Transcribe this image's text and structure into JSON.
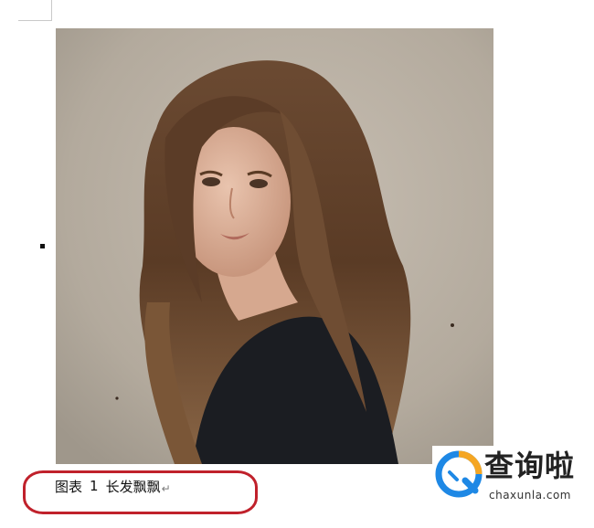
{
  "document": {
    "caption": {
      "label": "图表",
      "number": "1",
      "text": "长发飘飘",
      "paragraph_mark": "↵"
    },
    "photo": {
      "subject": "portrait-photo",
      "background_color": "#bcb3a7"
    },
    "highlight_color": "#c0212b"
  },
  "watermark": {
    "title": "查询啦",
    "domain": "chaxunla.com",
    "logo_color_blue": "#1e88e5",
    "logo_color_orange": "#f5a623"
  }
}
